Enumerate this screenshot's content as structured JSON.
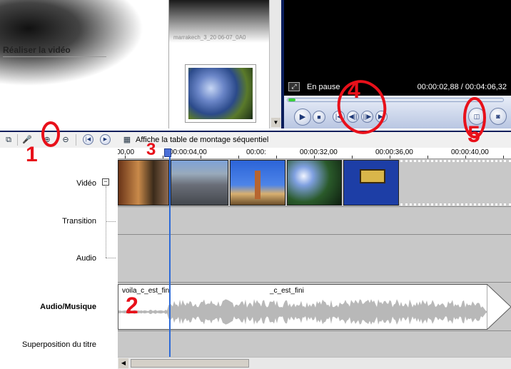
{
  "tasks_panel": {
    "link_text": "Réaliser la vidéo"
  },
  "collection": {
    "clip_name": "marrakech_3_20 06-07_0A0"
  },
  "monitor": {
    "state": "En pause",
    "time": "00:00:02,88 / 00:04:06,32",
    "buttons": {
      "play": "▶",
      "stop": "■",
      "prev_frame": "|◀",
      "back": "◀||",
      "forward": "||▶",
      "next_frame": "▶|",
      "split": "◫",
      "snapshot": "◙"
    }
  },
  "toolbar": {
    "storyboard_label": "Affiche la table de montage séquentiel"
  },
  "ruler": {
    "ticks": [
      "00,00",
      "00:00:04,00",
      "00:00:",
      "00:00:32,00",
      "00:00:36,00",
      "00:00:40,00"
    ]
  },
  "tracks": {
    "video": "Vidéo",
    "transition": "Transition",
    "audio": "Audio",
    "music": "Audio/Musique",
    "title": "Superposition du titre"
  },
  "music_clip": {
    "label_1": "voila_c_est_fini",
    "label_2": "_c_est_fini"
  },
  "annotations": {
    "n1": "1",
    "n2": "2",
    "n3": "3",
    "n4": "4",
    "n5": "5"
  },
  "colors": {
    "annotation": "#e8101a",
    "playhead": "#2d6bd8",
    "monitor_frame": "#0b1e5c"
  }
}
